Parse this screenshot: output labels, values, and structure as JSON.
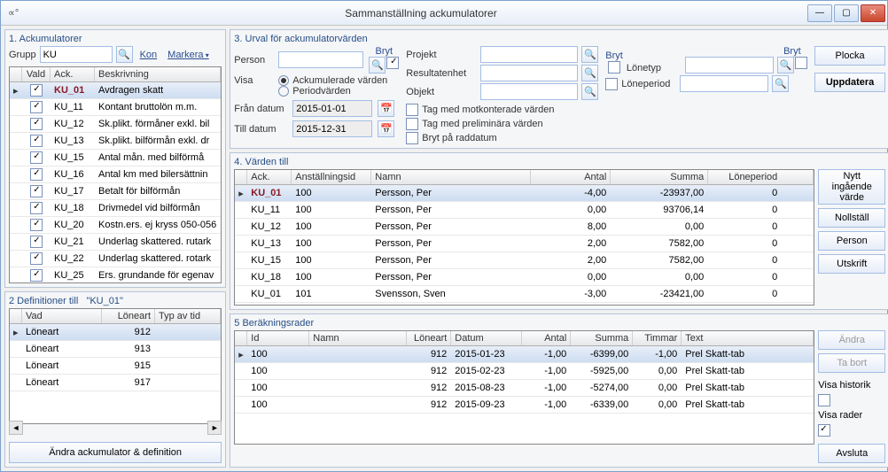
{
  "title": "Sammanställning ackumulatorer",
  "sec1": {
    "title": "1. Ackumulatorer",
    "group_label": "Grupp",
    "group_value": "KU",
    "kon_label": "Kon",
    "markera_label": "Markera",
    "cols": {
      "vald": "Vald",
      "ack": "Ack.",
      "besk": "Beskrivning"
    },
    "rows": [
      {
        "ack": "KU_01",
        "besk": "Avdragen skatt",
        "sel": true
      },
      {
        "ack": "KU_11",
        "besk": "Kontant bruttolön m.m."
      },
      {
        "ack": "KU_12",
        "besk": "Sk.plikt. förmåner exkl. bil"
      },
      {
        "ack": "KU_13",
        "besk": "Sk.plikt. bilförmån exkl. dr"
      },
      {
        "ack": "KU_15",
        "besk": "Antal mån. med bilförmå"
      },
      {
        "ack": "KU_16",
        "besk": "Antal km med bilersättnin"
      },
      {
        "ack": "KU_17",
        "besk": "Betalt för bilförmån"
      },
      {
        "ack": "KU_18",
        "besk": "Drivmedel vid bilförmån"
      },
      {
        "ack": "KU_20",
        "besk": "Kostn.ers. ej kryss 050-056"
      },
      {
        "ack": "KU_21",
        "besk": "Underlag skattered. rutark"
      },
      {
        "ack": "KU_22",
        "besk": "Underlag skattered. rotark"
      },
      {
        "ack": "KU_25",
        "besk": "Ers. grundande för egenav"
      }
    ],
    "bottom_btn": "Ändra ackumulator & definition"
  },
  "sec2": {
    "title_prefix": "2 Definitioner till",
    "title_code": "\"KU_01\"",
    "cols": {
      "vad": "Vad",
      "loan": "Löneart",
      "typ": "Typ av tid"
    },
    "rows": [
      {
        "vad": "Löneart",
        "loan": "912",
        "sel": true
      },
      {
        "vad": "Löneart",
        "loan": "913"
      },
      {
        "vad": "Löneart",
        "loan": "915"
      },
      {
        "vad": "Löneart",
        "loan": "917"
      }
    ]
  },
  "sec3": {
    "title": "3. Urval för ackumulatorvärden",
    "person": "Person",
    "visa": "Visa",
    "ack_varden": "Ackumulerade värden",
    "period_varden": "Periodvärden",
    "fran_datum": "Från datum",
    "till_datum": "Till datum",
    "fran_val": "2015-01-01",
    "till_val": "2015-12-31",
    "projekt": "Projekt",
    "resultatenhet": "Resultatenhet",
    "objekt": "Objekt",
    "lonetyp": "Lönetyp",
    "loneperiod": "Löneperiod",
    "bryt": "Bryt",
    "tag_mot": "Tag med motkonterade värden",
    "tag_prel": "Tag med preliminära värden",
    "bryt_radd": "Bryt på raddatum",
    "plocka": "Plocka",
    "uppdatera": "Uppdatera"
  },
  "sec4": {
    "title": "4. Värden till",
    "cols": {
      "ack": "Ack.",
      "anst": "Anställningsid",
      "namn": "Namn",
      "antal": "Antal",
      "summa": "Summa",
      "lonp": "Löneperiod"
    },
    "rows": [
      {
        "ack": "KU_01",
        "anst": "100",
        "namn": "Persson, Per",
        "antal": "-4,00",
        "summa": "-23937,00",
        "lonp": "0",
        "sel": true
      },
      {
        "ack": "KU_11",
        "anst": "100",
        "namn": "Persson, Per",
        "antal": "0,00",
        "summa": "93706,14",
        "lonp": "0"
      },
      {
        "ack": "KU_12",
        "anst": "100",
        "namn": "Persson, Per",
        "antal": "8,00",
        "summa": "0,00",
        "lonp": "0"
      },
      {
        "ack": "KU_13",
        "anst": "100",
        "namn": "Persson, Per",
        "antal": "2,00",
        "summa": "7582,00",
        "lonp": "0"
      },
      {
        "ack": "KU_15",
        "anst": "100",
        "namn": "Persson, Per",
        "antal": "2,00",
        "summa": "7582,00",
        "lonp": "0"
      },
      {
        "ack": "KU_18",
        "anst": "100",
        "namn": "Persson, Per",
        "antal": "0,00",
        "summa": "0,00",
        "lonp": "0"
      },
      {
        "ack": "KU_01",
        "anst": "101",
        "namn": "Svensson, Sven",
        "antal": "-3,00",
        "summa": "-23421,00",
        "lonp": "0"
      }
    ],
    "btns": {
      "nytt": "Nytt ingående värde",
      "nollstall": "Nollställ",
      "person": "Person",
      "utskrift": "Utskrift"
    }
  },
  "sec5": {
    "title": "5 Beräkningsrader",
    "cols": {
      "id": "Id",
      "namn": "Namn",
      "loan": "Löneart",
      "dat": "Datum",
      "ant": "Antal",
      "sum": "Summa",
      "tim": "Timmar",
      "text": "Text"
    },
    "rows": [
      {
        "id": "100",
        "loan": "912",
        "dat": "2015-01-23",
        "ant": "-1,00",
        "sum": "-6399,00",
        "tim": "-1,00",
        "text": "Prel Skatt-tab",
        "sel": true
      },
      {
        "id": "100",
        "loan": "912",
        "dat": "2015-02-23",
        "ant": "-1,00",
        "sum": "-5925,00",
        "tim": "0,00",
        "text": "Prel Skatt-tab"
      },
      {
        "id": "100",
        "loan": "912",
        "dat": "2015-08-23",
        "ant": "-1,00",
        "sum": "-5274,00",
        "tim": "0,00",
        "text": "Prel Skatt-tab"
      },
      {
        "id": "100",
        "loan": "912",
        "dat": "2015-09-23",
        "ant": "-1,00",
        "sum": "-6339,00",
        "tim": "0,00",
        "text": "Prel Skatt-tab"
      }
    ],
    "andra": "Ändra",
    "tabort": "Ta bort",
    "visa_hist": "Visa historik",
    "visa_rader": "Visa rader",
    "avsluta": "Avsluta"
  }
}
